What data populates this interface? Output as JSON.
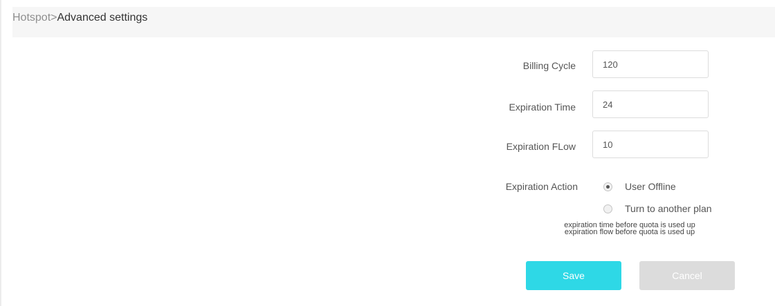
{
  "breadcrumb": {
    "root": "Hotspot",
    "separator": ">",
    "current": "Advanced settings"
  },
  "form": {
    "billing_cycle": {
      "label": "Billing Cycle",
      "value": "120"
    },
    "expiration_time": {
      "label": "Expiration Time",
      "value": "24"
    },
    "expiration_flow": {
      "label": "Expiration FLow",
      "value": "10"
    },
    "expiration_action": {
      "label": "Expiration Action",
      "options": [
        {
          "label": "User Offline",
          "checked": true
        },
        {
          "label": "Turn to another plan",
          "checked": false
        }
      ]
    },
    "notes": [
      "expiration time before quota is used up",
      "expiration flow before quota is used up"
    ]
  },
  "buttons": {
    "save": {
      "label": "Save",
      "color": "#2ed8e6"
    },
    "cancel": {
      "label": "Cancel",
      "color": "#dcdcdc"
    }
  }
}
